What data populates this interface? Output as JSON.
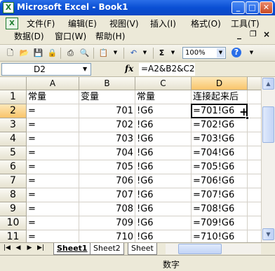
{
  "window": {
    "title": "Microsoft Excel - Book1"
  },
  "menu": {
    "row1": [
      "文件(F)",
      "编辑(E)",
      "视图(V)",
      "插入(I)",
      "格式(O)",
      "工具(T)"
    ],
    "row2": [
      "数据(D)",
      "窗口(W)",
      "帮助(H)"
    ]
  },
  "toolbar": {
    "zoom": "100%"
  },
  "formula_bar": {
    "name_box": "D2",
    "fx": "fx",
    "formula": "=A2&B2&C2"
  },
  "grid": {
    "columns": [
      "A",
      "B",
      "C",
      "D"
    ],
    "rows": [
      {
        "n": "1",
        "a": "常量",
        "b": "变量",
        "c": "常量",
        "d": "连接起来后"
      },
      {
        "n": "2",
        "a": "=",
        "b": "701",
        "c": "!G6",
        "d": "=701!G6"
      },
      {
        "n": "3",
        "a": "=",
        "b": "702",
        "c": "!G6",
        "d": "=702!G6"
      },
      {
        "n": "4",
        "a": "=",
        "b": "703",
        "c": "!G6",
        "d": "=703!G6"
      },
      {
        "n": "5",
        "a": "=",
        "b": "704",
        "c": "!G6",
        "d": "=704!G6"
      },
      {
        "n": "6",
        "a": "=",
        "b": "705",
        "c": "!G6",
        "d": "=705!G6"
      },
      {
        "n": "7",
        "a": "=",
        "b": "706",
        "c": "!G6",
        "d": "=706!G6"
      },
      {
        "n": "8",
        "a": "=",
        "b": "707",
        "c": "!G6",
        "d": "=707!G6"
      },
      {
        "n": "9",
        "a": "=",
        "b": "708",
        "c": "!G6",
        "d": "=708!G6"
      },
      {
        "n": "10",
        "a": "=",
        "b": "709",
        "c": "!G6",
        "d": "=709!G6"
      },
      {
        "n": "11",
        "a": "=",
        "b": "710",
        "c": "!G6",
        "d": "=710!G6"
      },
      {
        "n": "12",
        "a": "",
        "b": "",
        "c": "",
        "d": "=711!G6"
      }
    ]
  },
  "sheets": [
    "Sheet1",
    "Sheet2",
    "Sheet"
  ],
  "status": {
    "mode": "数字"
  }
}
